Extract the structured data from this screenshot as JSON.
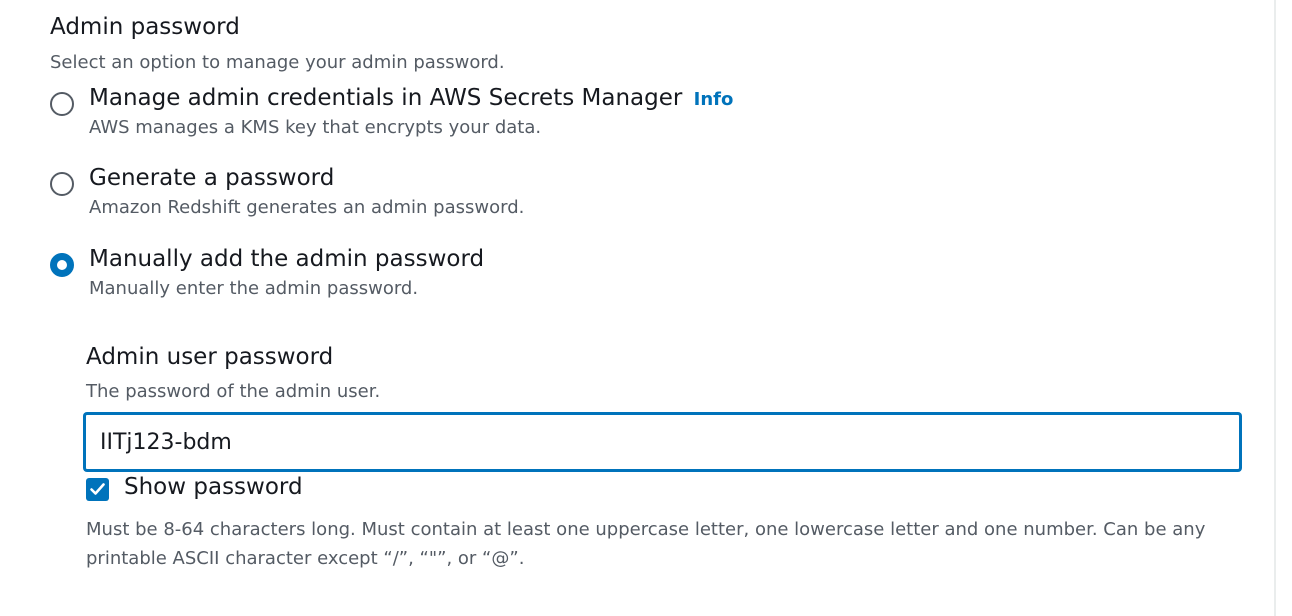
{
  "section": {
    "title": "Admin password",
    "description": "Select an option to manage your admin password."
  },
  "options": [
    {
      "label": "Manage admin credentials in AWS Secrets Manager",
      "info": "Info",
      "description": "AWS manages a KMS key that encrypts your data.",
      "checked": false
    },
    {
      "label": "Generate a password",
      "description": "Amazon Redshift generates an admin password.",
      "checked": false
    },
    {
      "label": "Manually add the admin password",
      "description": "Manually enter the admin password.",
      "checked": true
    }
  ],
  "password_field": {
    "label": "Admin user password",
    "description": "The password of the admin user.",
    "value": "IITj123-bdm"
  },
  "show_password": {
    "label": "Show password",
    "checked": true
  },
  "constraints": "Must be 8-64 characters long. Must contain at least one uppercase letter, one lowercase letter and one number. Can be any printable ASCII character except “/”, “\"”, or “@”.",
  "colors": {
    "accent": "#0073bb",
    "text": "#16191f",
    "secondary_text": "#545b64"
  }
}
